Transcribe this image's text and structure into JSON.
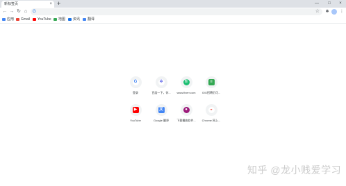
{
  "tab": {
    "title": "新标签页",
    "close": "×"
  },
  "new_tab": "+",
  "window_controls": {
    "minimize": "—",
    "maximize": "□",
    "close": "×"
  },
  "toolbar": {
    "back": "←",
    "forward": "→",
    "reload": "↻",
    "home": "⌂",
    "omnibox_icon": "G",
    "star": "☆",
    "extensions": "✱",
    "menu": "⋮"
  },
  "bookmarks": [
    {
      "label": "应用",
      "icon": "apps-icon",
      "color": "#4285f4"
    },
    {
      "label": "Gmail",
      "icon": "gmail-icon",
      "color": "#ea4335"
    },
    {
      "label": "YouTube",
      "icon": "youtube-icon",
      "color": "#ff0000"
    },
    {
      "label": "地图",
      "icon": "maps-icon",
      "color": "#34a853"
    },
    {
      "label": "资讯",
      "icon": "news-icon",
      "color": "#1a73e8"
    },
    {
      "label": "翻译",
      "icon": "translate-icon",
      "color": "#4285f4"
    }
  ],
  "shortcuts": [
    {
      "label": "登录",
      "icon": "google-icon",
      "glyph": "G",
      "color": "#ffffff",
      "glyph_color": "#4285f4"
    },
    {
      "label": "百度一下，你...",
      "icon": "baidu-icon",
      "glyph": "✲",
      "color": "#ffffff",
      "glyph_color": "#2932e1"
    },
    {
      "label": "www.fiverr.com",
      "icon": "fiverr-icon",
      "glyph": "fi",
      "color": "#1dbf73",
      "glyph_color": "#ffffff"
    },
    {
      "label": "IOG招聘仍可...",
      "icon": "iog-icon",
      "glyph": "≡",
      "color": "#34a853",
      "glyph_color": "#ffffff"
    },
    {
      "label": "YouTube",
      "icon": "youtube-icon",
      "glyph": "▶",
      "color": "#ff0000",
      "glyph_color": "#ffffff"
    },
    {
      "label": "Google 翻译",
      "icon": "google-translate-icon",
      "glyph": "文",
      "color": "#4285f4",
      "glyph_color": "#ffffff"
    },
    {
      "label": "下载播放软件...",
      "icon": "player-icon",
      "glyph": "●",
      "color": "#9c1a7a",
      "glyph_color": "#ffffff"
    },
    {
      "label": "Chrome 网上...",
      "icon": "chrome-webstore-icon",
      "glyph": "◒",
      "color": "#ffffff",
      "glyph_color": "#ea4335"
    }
  ],
  "watermark": "知乎 @龙小贱爱学习"
}
